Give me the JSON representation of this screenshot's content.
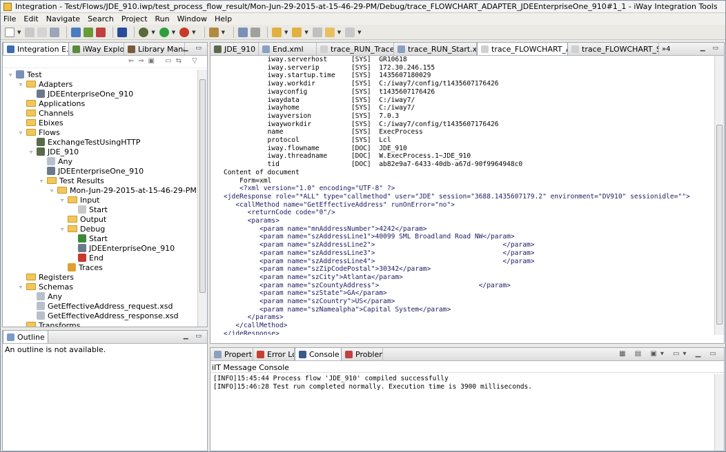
{
  "window": {
    "title": "Integration - Test/Flows/JDE_910.iwp/test_process_flow_result/Mon-Jun-29-2015-at-15-46-29-PM/Debug/trace_FLOWCHART_ADAPTER_JDEEnterpriseOne_910#1_1 - iWay Integration Tools"
  },
  "menu": [
    "File",
    "Edit",
    "Navigate",
    "Search",
    "Project",
    "Run",
    "Window",
    "Help"
  ],
  "left_panel": {
    "tabs": [
      "Integration E...",
      "iWay Explorer",
      "Library Mana..."
    ],
    "tree": [
      {
        "label": "Test",
        "indent": 0,
        "icon": "project-icon",
        "twisty": "▿"
      },
      {
        "label": "Adapters",
        "indent": 1,
        "icon": "folder-icon",
        "twisty": "▿"
      },
      {
        "label": "JDEEnterpriseOne_910",
        "indent": 2,
        "icon": "adapter-icon",
        "twisty": ""
      },
      {
        "label": "Applications",
        "indent": 1,
        "icon": "folder-icon",
        "twisty": ""
      },
      {
        "label": "Channels",
        "indent": 1,
        "icon": "folder-icon",
        "twisty": ""
      },
      {
        "label": "Ebixes",
        "indent": 1,
        "icon": "folder-icon",
        "twisty": ""
      },
      {
        "label": "Flows",
        "indent": 1,
        "icon": "folder-icon",
        "twisty": "▿"
      },
      {
        "label": "ExchangeTestUsingHTTP",
        "indent": 2,
        "icon": "flow-icon",
        "twisty": ""
      },
      {
        "label": "JDE_910",
        "indent": 2,
        "icon": "flow-icon",
        "twisty": "▿"
      },
      {
        "label": "Any",
        "indent": 3,
        "icon": "xsd-icon",
        "twisty": ""
      },
      {
        "label": "JDEEnterpriseOne_910",
        "indent": 3,
        "icon": "adapter-icon",
        "twisty": ""
      },
      {
        "label": "Test Results",
        "indent": 3,
        "icon": "folder-icon",
        "twisty": "▿"
      },
      {
        "label": "Mon-Jun-29-2015-at-15-46-29-PM",
        "indent": 4,
        "icon": "folder-icon",
        "twisty": "▿"
      },
      {
        "label": "Input",
        "indent": 5,
        "icon": "folder-icon",
        "twisty": "▿"
      },
      {
        "label": "Start",
        "indent": 6,
        "icon": "xml-icon",
        "twisty": ""
      },
      {
        "label": "Output",
        "indent": 5,
        "icon": "folder-icon",
        "twisty": ""
      },
      {
        "label": "Debug",
        "indent": 5,
        "icon": "folder-icon",
        "twisty": "▿"
      },
      {
        "label": "Start",
        "indent": 6,
        "icon": "start-icon",
        "twisty": ""
      },
      {
        "label": "JDEEnterpriseOne_910",
        "indent": 6,
        "icon": "adapter-icon",
        "twisty": ""
      },
      {
        "label": "End",
        "indent": 6,
        "icon": "end-icon",
        "twisty": ""
      },
      {
        "label": "Traces",
        "indent": 5,
        "icon": "traces-icon",
        "twisty": ""
      },
      {
        "label": "Registers",
        "indent": 1,
        "icon": "folder-icon",
        "twisty": ""
      },
      {
        "label": "Schemas",
        "indent": 1,
        "icon": "folder-icon",
        "twisty": "▿"
      },
      {
        "label": "Any",
        "indent": 2,
        "icon": "xsd-icon",
        "twisty": ""
      },
      {
        "label": "GetEffectiveAddress_request.xsd",
        "indent": 2,
        "icon": "xsd-icon",
        "twisty": ""
      },
      {
        "label": "GetEffectiveAddress_response.xsd",
        "indent": 2,
        "icon": "xsd-icon",
        "twisty": ""
      },
      {
        "label": "Transforms",
        "indent": 1,
        "icon": "folder-icon",
        "twisty": ""
      }
    ]
  },
  "outline": {
    "tab": "Outline",
    "message": "An outline is not available."
  },
  "editor": {
    "tabs": [
      {
        "label": "JDE_910",
        "active": false,
        "icon": "flow-icon"
      },
      {
        "label": "End.xml",
        "active": false,
        "icon": "xml-icon"
      },
      {
        "label": "trace_RUN_Traces",
        "active": false,
        "icon": "trace-icon"
      },
      {
        "label": "trace_RUN_Start.xml",
        "active": false,
        "icon": "xml-icon"
      },
      {
        "label": "trace_FLOWCHART_A...",
        "active": true,
        "icon": "trace-icon"
      },
      {
        "label": "trace_FLOWCHART_S...",
        "active": false,
        "icon": "trace-icon"
      }
    ],
    "overflow": "»4",
    "lines": [
      "           iway.serverhost      [SYS]  GR10618",
      "           iway.serverip        [SYS]  172.30.246.155",
      "           iway.startup.time    [SYS]  1435607180029",
      "           iway.workdir         [SYS]  C:/iway7/config/t1435607176426",
      "           iwayconfig           [SYS]  t1435607176426",
      "           iwaydata             [SYS]  C:/iway7/",
      "           iwayhome             [SYS]  C:/iway7/",
      "           iwayversion          [SYS]  7.0.3",
      "           iwayworkdir          [SYS]  C:/iway7/config/t1435607176426",
      "           name                 [SYS]  ExecProcess",
      "           protocol             [SYS]  Lcl",
      "           iway.flowname        [DOC]  JDE_910",
      "           iway.threadname      [DOC]  W.ExecProcess.1~JDE_910",
      "           tid                  [DOC]  ab82e9a7-6433-40db-a67d-90f9964948c0",
      "Content of document",
      "    Form=xml",
      "    <?xml version=\"1.0\" encoding=\"UTF-8\" ?>",
      "<jdeResponse role=\"*ALL\" type=\"callmethod\" user=\"JDE\" session=\"3688.1435607179.2\" environment=\"DV910\" sessionidle=\"\">",
      "   <callMethod name=\"GetEffectiveAddress\" runOnError=\"no\">",
      "      <returnCode code=\"0\"/>",
      "      <params>",
      "         <param name=\"mnAddressNumber\">4242</param>",
      "         <param name=\"szAddressLine1\">40099 SML Broadland Road NW</param>",
      "         <param name=\"szAddressLine2\">                                </param>",
      "         <param name=\"szAddressLine3\">                                </param>",
      "         <param name=\"szAddressLine4\">                                </param>",
      "         <param name=\"szZipCodePostal\">30342</param>",
      "         <param name=\"szCity\">Atlanta</param>",
      "         <param name=\"szCountyAddress\">                         </param>",
      "         <param name=\"szState\">GA</param>",
      "         <param name=\"szCountry\">US</param>",
      "         <param name=\"szNamealpha\">Capital System</param>",
      "      </params>",
      "   </callMethod>",
      "</jdeResponse>"
    ]
  },
  "bottom": {
    "tabs": [
      "Properties",
      "Error Log",
      "Console",
      "Problems"
    ],
    "active_tab": "Console",
    "console_title": "iIT Message Console",
    "lines": [
      "[INFO]15:45:44 Process flow 'JDE_910' compiled successfully",
      "[INFO]15:46:28 Test run completed normally. Execution time is 3900 milliseconds."
    ]
  },
  "colors": {
    "folder": "#f3c65a",
    "accent": "#3c6eb4",
    "tag": "#8b0000",
    "attr": "#1a1a80"
  }
}
